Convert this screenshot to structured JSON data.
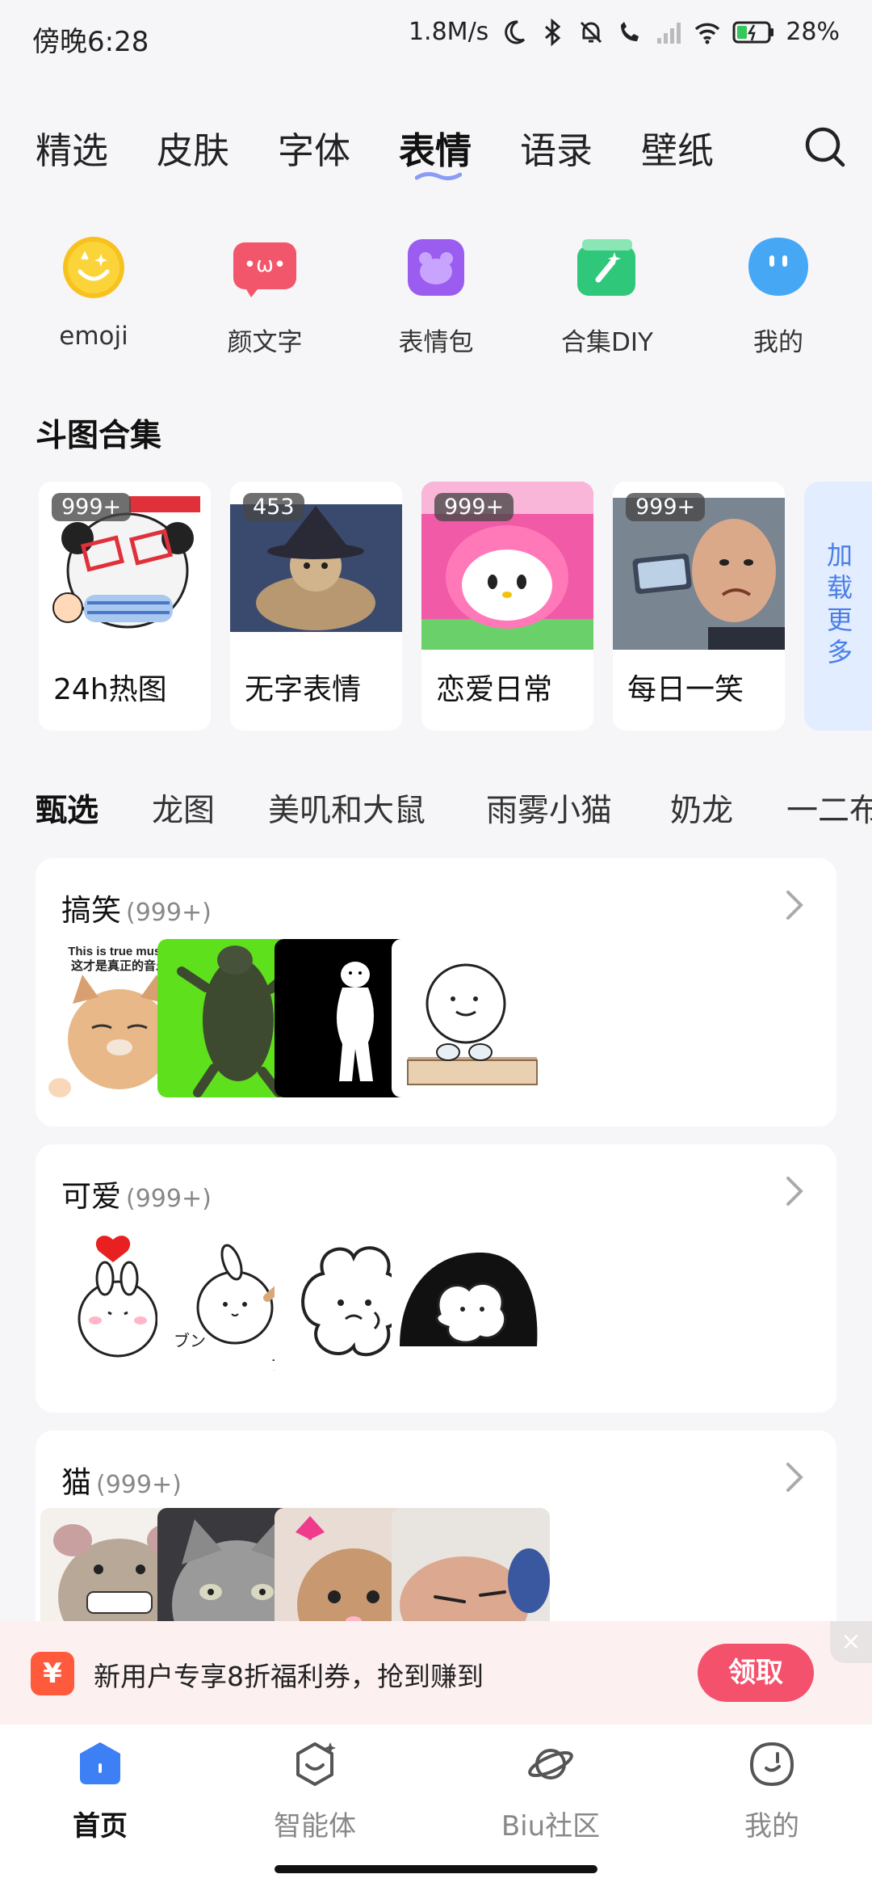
{
  "status_bar": {
    "time": "傍晚6:28",
    "speed": "1.8M/s",
    "battery": "28%"
  },
  "top_tabs": {
    "items": [
      "精选",
      "皮肤",
      "字体",
      "表情",
      "语录",
      "壁纸"
    ],
    "active": "表情"
  },
  "shortcuts": [
    {
      "label": "emoji",
      "icon": "emoji-face-icon",
      "color": "#f7c21f"
    },
    {
      "label": "颜文字",
      "icon": "kaomoji-icon",
      "color": "#f2566a"
    },
    {
      "label": "表情包",
      "icon": "sticker-pack-icon",
      "color": "#9b5cf0"
    },
    {
      "label": "合集DIY",
      "icon": "diy-collection-icon",
      "color": "#2fc77a"
    },
    {
      "label": "我的",
      "icon": "my-face-icon",
      "color": "#46a8f5"
    }
  ],
  "doutu": {
    "title": "斗图合集",
    "cards": [
      {
        "label": "24h热图",
        "badge": "999+"
      },
      {
        "label": "无字表情",
        "badge": "453"
      },
      {
        "label": "恋爱日常",
        "badge": "999+"
      },
      {
        "label": "每日一笑",
        "badge": "999+"
      }
    ],
    "load_more": "加载更多"
  },
  "category_tabs": [
    "甄选",
    "龙图",
    "美叽和大鼠",
    "雨雾小猫",
    "奶龙",
    "一二布"
  ],
  "sections": [
    {
      "title": "搞笑",
      "count": "(999+)"
    },
    {
      "title": "可爱",
      "count": "(999+)"
    },
    {
      "title": "猫",
      "count": "(999+)"
    }
  ],
  "funny_thumb_text": {
    "line1": "This is true music",
    "line2": "这才是真正的音乐"
  },
  "banner": {
    "icon_char": "¥",
    "text": "新用户专享8折福利券，抢到赚到",
    "button": "领取",
    "close": "×"
  },
  "bottom_nav": [
    {
      "label": "首页",
      "icon": "home-icon",
      "active": true
    },
    {
      "label": "智能体",
      "icon": "agent-icon",
      "active": false
    },
    {
      "label": "Biu社区",
      "icon": "planet-icon",
      "active": false
    },
    {
      "label": "我的",
      "icon": "profile-icon",
      "active": false
    }
  ],
  "colors": {
    "accent_blue": "#3d7ff5",
    "coupon_red": "#f4516c",
    "page_bg": "#f6f6f8"
  }
}
